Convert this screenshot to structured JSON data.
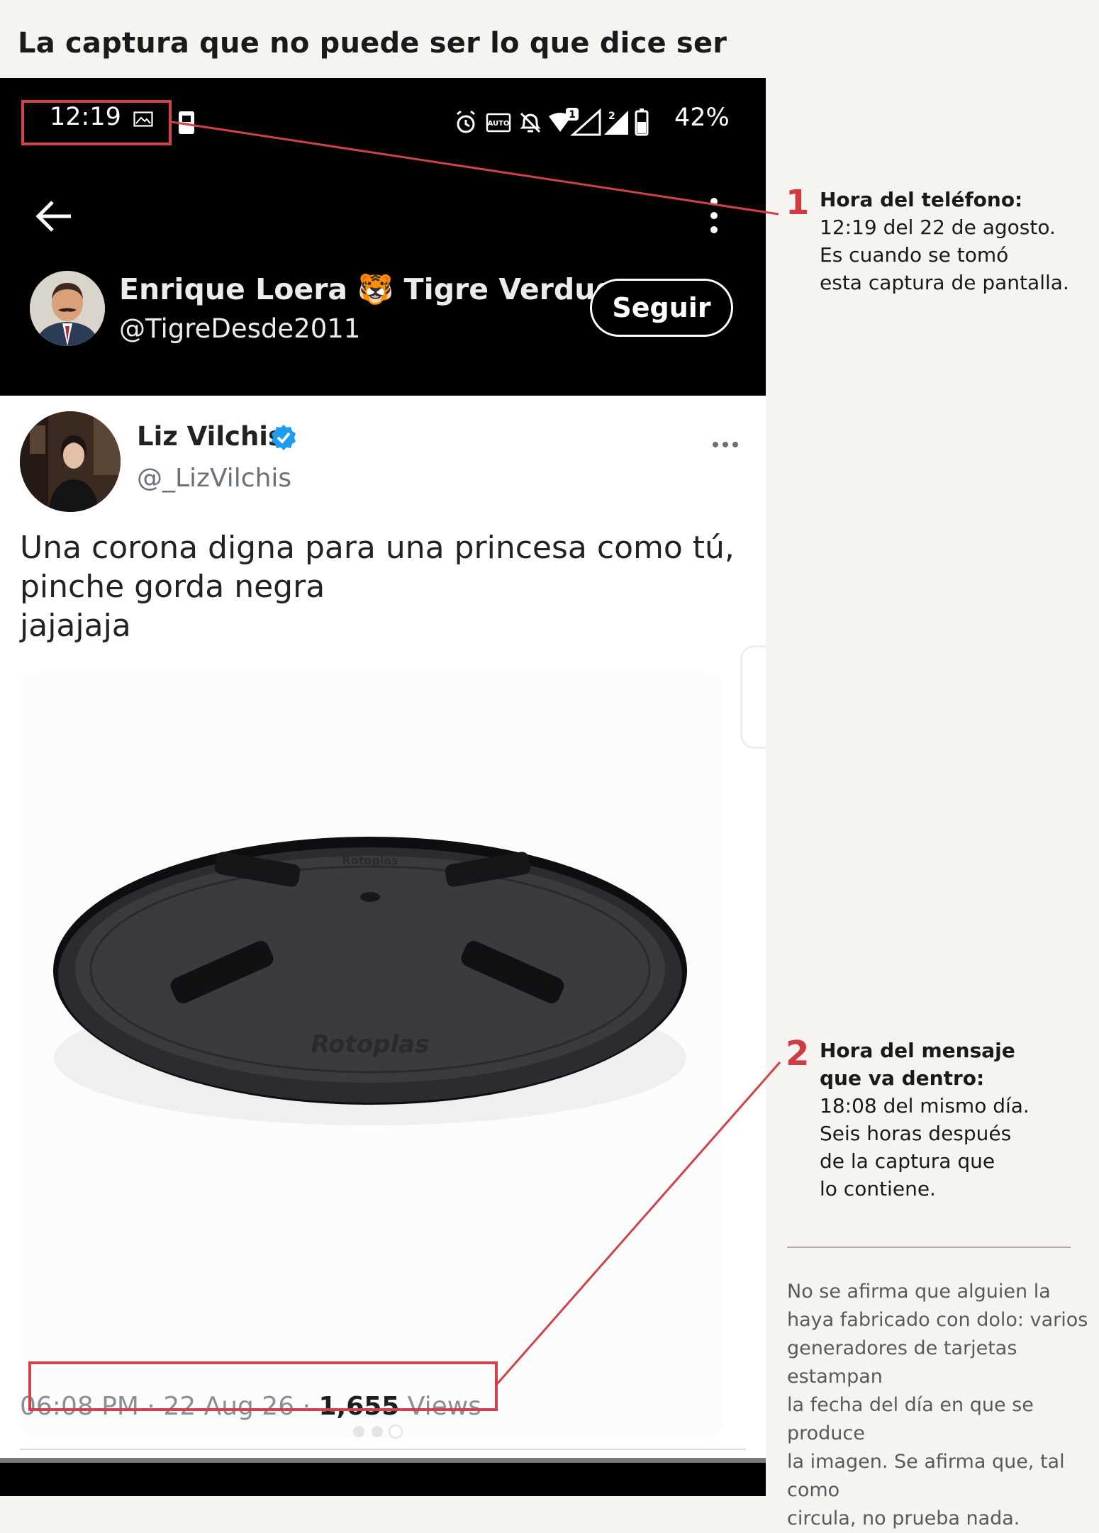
{
  "headline": "La captura que no puede ser lo que dice ser",
  "status_bar": {
    "time": "12:19",
    "battery": "42%",
    "icons": [
      "image-icon",
      "sim-icon",
      "alarm-icon",
      "auto-hz-icon",
      "bell-off-icon",
      "wifi-icon",
      "signal-1-icon",
      "signal-2-icon",
      "battery-icon"
    ]
  },
  "profile_header": {
    "name": "Enrique Loera 🐯 Tigre Verdugo",
    "handle": "@TigreDesde2011",
    "follow_label": "Seguir"
  },
  "tweet": {
    "author": "Liz Vilchis",
    "handle": "@_LizVilchis",
    "text": "Una corona digna para una princesa como tú,\npinche gorda negra\njajajaja",
    "time": "06:08 PM",
    "sep1": " · ",
    "date": "22 Aug 26",
    "sep2": " · ",
    "views_count": "1,655",
    "views_label": " Views",
    "image_brand": "Rotoplas"
  },
  "annotations": [
    {
      "number": "1",
      "title": "Hora del teléfono:",
      "body": "12:19 del 22 de agosto.\nEs cuando se tomó\nesta captura de pantalla."
    },
    {
      "number": "2",
      "title": "Hora del mensaje\nque va dentro:",
      "body": "18:08 del mismo día.\nSeis horas después\nde la captura que\nlo contiene."
    }
  ],
  "disclaimer": "No se afirma que alguien la\nhaya fabricado con dolo: varios\ngeneradores de tarjetas estampan\nla fecha del día en que se produce\nla imagen. Se afirma que, tal como\ncircula, no prueba nada.",
  "colors": {
    "annotation_red": "#d0424a",
    "page_bg": "#f5f4f0",
    "verified_blue": "#1d9bf0"
  }
}
